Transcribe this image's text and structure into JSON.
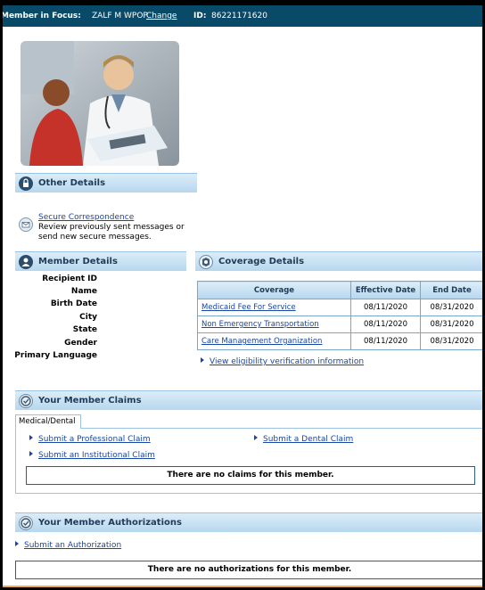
{
  "topbar": {
    "member_label": "Member in Focus:",
    "member_name": "ZALF M WPOP",
    "change_link": "Change",
    "id_label": "ID:",
    "id_value": "86221171620"
  },
  "other_details": {
    "title": "Other Details",
    "secure_link": "Secure Correspondence",
    "secure_desc_1": "Review previously sent messages or",
    "secure_desc_2": "send new secure messages."
  },
  "member_details": {
    "title": "Member Details",
    "fields": [
      "Recipient ID",
      "Name",
      "Birth Date",
      "City",
      "State",
      "Gender",
      "Primary Language"
    ]
  },
  "coverage": {
    "title": "Coverage Details",
    "headers": [
      "Coverage",
      "Effective Date",
      "End Date"
    ],
    "rows": [
      {
        "coverage": "Medicaid Fee For Service",
        "effective": "08/11/2020",
        "end": "08/31/2020"
      },
      {
        "coverage": "Non Emergency Transportation",
        "effective": "08/11/2020",
        "end": "08/31/2020"
      },
      {
        "coverage": "Care Management Organization",
        "effective": "08/11/2020",
        "end": "08/31/2020"
      }
    ],
    "eligibility_link": "View eligibility verification information"
  },
  "claims": {
    "title": "Your Member Claims",
    "tab": "Medical/Dental",
    "professional_link": "Submit a Professional Claim",
    "dental_link": "Submit a Dental Claim",
    "institutional_link": "Submit an Institutional Claim",
    "empty_message": "There are no claims for this member."
  },
  "authorizations": {
    "title": "Your Member Authorizations",
    "submit_link": "Submit an Authorization",
    "empty_message": "There are no authorizations for this member."
  },
  "colors": {
    "topbar": "#084a68",
    "section_header": "#b6d7ee",
    "link": "#1a46a4",
    "border": "#7aa7c9"
  },
  "icons": [
    "lock-icon",
    "envelope-icon",
    "member-icon",
    "coverage-icon",
    "claims-icon",
    "authorizations-icon"
  ]
}
